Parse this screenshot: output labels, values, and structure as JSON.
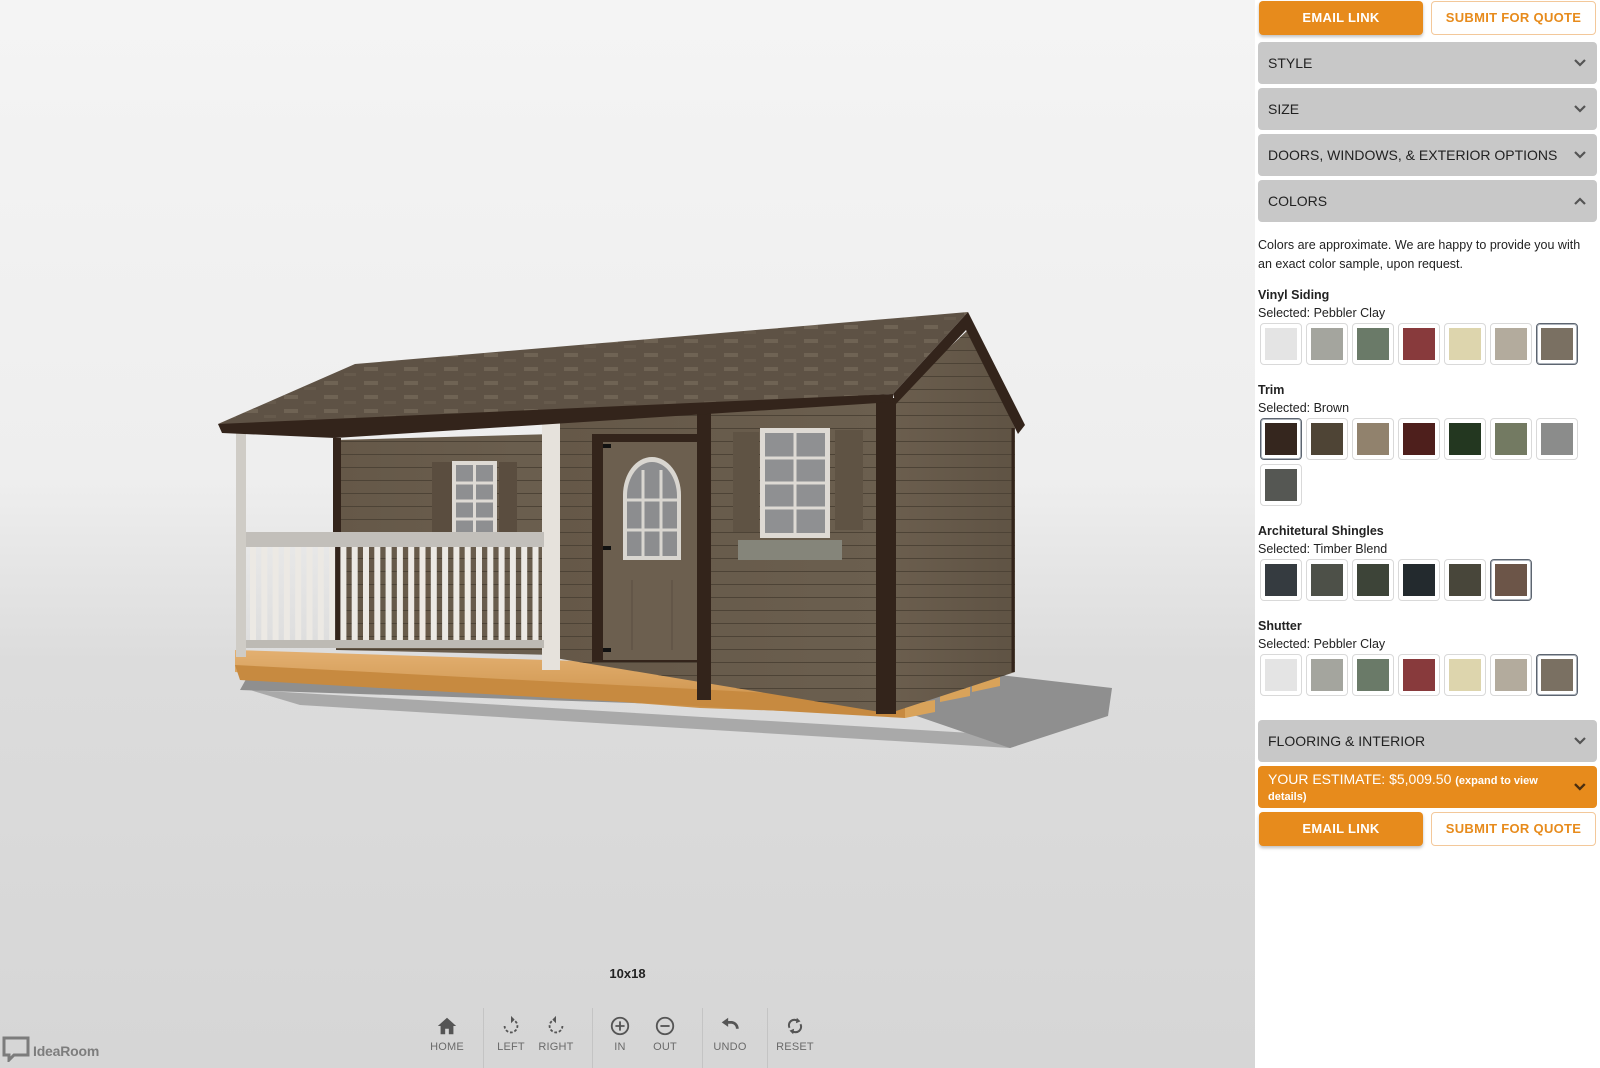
{
  "viewer": {
    "size_label": "10x18",
    "toolbar": [
      {
        "id": "home",
        "label": "HOME",
        "icon": "home-icon"
      },
      {
        "id": "left",
        "label": "LEFT",
        "icon": "rotate-left-icon"
      },
      {
        "id": "right",
        "label": "RIGHT",
        "icon": "rotate-right-icon"
      },
      {
        "id": "in",
        "label": "IN",
        "icon": "zoom-in-icon"
      },
      {
        "id": "out",
        "label": "OUT",
        "icon": "zoom-out-icon"
      },
      {
        "id": "undo",
        "label": "UNDO",
        "icon": "undo-icon"
      },
      {
        "id": "reset",
        "label": "RESET",
        "icon": "reset-icon"
      }
    ],
    "logo_text": "IdeaRoom"
  },
  "actions": {
    "email_link": "EMAIL LINK",
    "submit_quote": "SUBMIT FOR QUOTE"
  },
  "accordion": {
    "style": "STYLE",
    "size": "SIZE",
    "doors": "DOORS, WINDOWS, & EXTERIOR OPTIONS",
    "colors": "COLORS",
    "flooring": "FLOORING & INTERIOR"
  },
  "estimate": {
    "label": "YOUR ESTIMATE: $5,009.50",
    "hint": "(expand to view details)"
  },
  "colors": {
    "note": "Colors are approximate. We are happy to provide you with an exact color sample, upon request.",
    "groups": [
      {
        "title": "Vinyl Siding",
        "selected_text": "Selected: Pebbler Clay",
        "swatches": [
          "#e4e4e4",
          "#a4a59e",
          "#6a7a68",
          "#883a3c",
          "#ddd5ad",
          "#b3ab9d",
          "#7a7062"
        ],
        "selected_index": 6
      },
      {
        "title": "Trim",
        "selected_text": "Selected: Brown",
        "swatches": [
          "#35261e",
          "#4e4435",
          "#91826d",
          "#4e1f1c",
          "#233720",
          "#737a62",
          "#8b8c8b",
          "#555753"
        ],
        "selected_index": 0
      },
      {
        "title": "Architetural Shingles",
        "selected_text": "Selected: Timber Blend",
        "swatches": [
          "#353b40",
          "#4d5048",
          "#3d4438",
          "#232a2e",
          "#48463a",
          "#6c5548"
        ],
        "selected_index": 5
      },
      {
        "title": "Shutter",
        "selected_text": "Selected: Pebbler Clay",
        "swatches": [
          "#e4e4e4",
          "#a4a59e",
          "#6a7a68",
          "#883a3c",
          "#ddd5ad",
          "#b3ab9d",
          "#7a7062"
        ],
        "selected_index": 6
      }
    ]
  },
  "theme": {
    "accent": "#e78b1c",
    "accordion_bg": "#c8c8c8"
  }
}
